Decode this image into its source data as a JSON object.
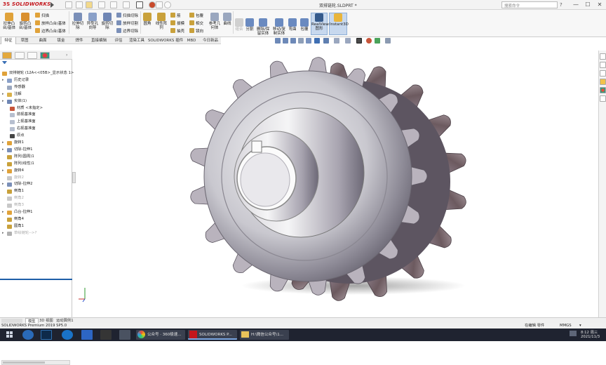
{
  "titlebar": {
    "logo_ds": "3S",
    "logo": "SOLIDWORKS",
    "doc_title": "双排链轮.SLDPRT *",
    "search_placeholder": "搜索命令",
    "min": "—",
    "max": "☐",
    "close": "✕"
  },
  "ribbon": {
    "big": [
      {
        "label": "拉伸凸\n台/基体"
      },
      {
        "label": "旋转凸\n台/基体"
      },
      {
        "label": "拉伸切\n除"
      },
      {
        "label": "异型孔\n向导"
      },
      {
        "label": "旋转切\n除"
      },
      {
        "label": "圆角"
      },
      {
        "label": "线性阵\n列"
      },
      {
        "label": "参考几\n何体"
      },
      {
        "label": "曲线"
      },
      {
        "label": "组合"
      },
      {
        "label": "分割"
      },
      {
        "label": "删除/保\n留实体"
      },
      {
        "label": "移动/复\n制实体"
      },
      {
        "label": "弯曲"
      },
      {
        "label": "包覆"
      },
      {
        "label": "RealView\n图形"
      },
      {
        "label": "Instant3D"
      }
    ],
    "small": [
      "扫描",
      "放样凸台/基体",
      "边界凸台/基体",
      "扫描切除",
      "放样切割",
      "边界切除",
      "筋",
      "拔模",
      "抽壳",
      "包覆",
      "相交",
      "镜向",
      "包覆"
    ]
  },
  "tabs": [
    "特征",
    "草图",
    "曲面",
    "钣金",
    "焊件",
    "直接编辑",
    "评估",
    "渲染工具",
    "SOLIDWORKS 插件",
    "MBD",
    "今日新品"
  ],
  "tree": [
    {
      "label": "双排链轮 (12A<<05B>_显示状态 1>",
      "expand": ""
    },
    {
      "label": "历史记录",
      "expand": "▸"
    },
    {
      "label": "传感器",
      "expand": ""
    },
    {
      "label": "注解",
      "expand": "▸"
    },
    {
      "label": "实体(1)",
      "expand": "▸"
    },
    {
      "label": "材质 <未指定>",
      "expand": ""
    },
    {
      "label": "前视基准面",
      "expand": ""
    },
    {
      "label": "上视基准面",
      "expand": ""
    },
    {
      "label": "右视基准面",
      "expand": ""
    },
    {
      "label": "原点",
      "expand": ""
    },
    {
      "label": "旋转1",
      "expand": "▸"
    },
    {
      "label": "切除-拉伸1",
      "expand": "▸"
    },
    {
      "label": "阵列(圆周)1",
      "expand": ""
    },
    {
      "label": "阵列(线性)1",
      "expand": ""
    },
    {
      "label": "旋转4",
      "expand": "▸"
    },
    {
      "label": "旋转2",
      "expand": ""
    },
    {
      "label": "切除-拉伸2",
      "expand": "▸"
    },
    {
      "label": "倒角1",
      "expand": ""
    },
    {
      "label": "倒角2",
      "expand": ""
    },
    {
      "label": "倒角3",
      "expand": ""
    },
    {
      "label": "凸台-拉伸1",
      "expand": "▸"
    },
    {
      "label": "倒角4",
      "expand": ""
    },
    {
      "label": "圆角1",
      "expand": ""
    },
    {
      "label": "草绘链轮-->?",
      "expand": "▸"
    }
  ],
  "bottom_tabs": [
    "模型",
    "3D 视图",
    "运动算例1"
  ],
  "statusbar": {
    "left": "SOLIDWORKS Premium 2019 SP5.0",
    "mode": "在编辑 零件",
    "units": "MMGS",
    "arrow": "▾"
  },
  "taskbar": {
    "items": [
      "公众号 · 360极速...",
      "SOLIDWORKS P...",
      "H:\\微信公众号\\1..."
    ],
    "time": "8:12 周三",
    "date": "2021/11/3"
  },
  "colors": {
    "accent": "#c4161c",
    "selection": "#1e5fa8",
    "taskbar": "#1f2330"
  }
}
